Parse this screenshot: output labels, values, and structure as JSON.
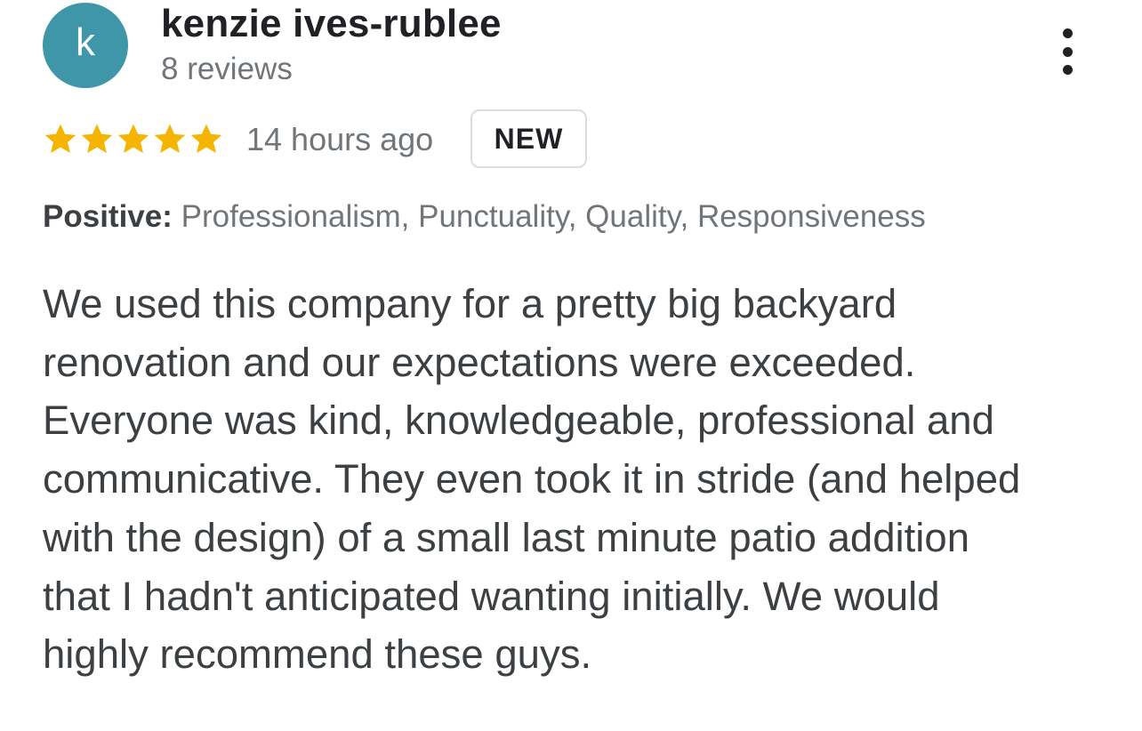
{
  "reviewer": {
    "avatar_letter": "k",
    "avatar_color": "#3f96a8",
    "name": "kenzie ives-rublee",
    "review_count": "8 reviews"
  },
  "menu": {
    "icon": "more-vert-icon"
  },
  "rating": {
    "value": 5,
    "max": 5,
    "star_color": "#f4b400",
    "star_icon": "star-icon"
  },
  "time_ago": "14 hours ago",
  "badge": "NEW",
  "attributes": {
    "label": "Positive:",
    "values": "Professionalism, Punctuality, Quality, Responsiveness"
  },
  "review_lines": [
    "We used this company for a pretty big backyard",
    "renovation and our expectations were exceeded.",
    "Everyone was kind, knowledgeable, professional and",
    "communicative. They even took it in stride (and helped",
    "with the design) of a small last minute patio addition",
    "that I hadn't anticipated wanting initially. We would",
    "highly recommend these guys."
  ]
}
